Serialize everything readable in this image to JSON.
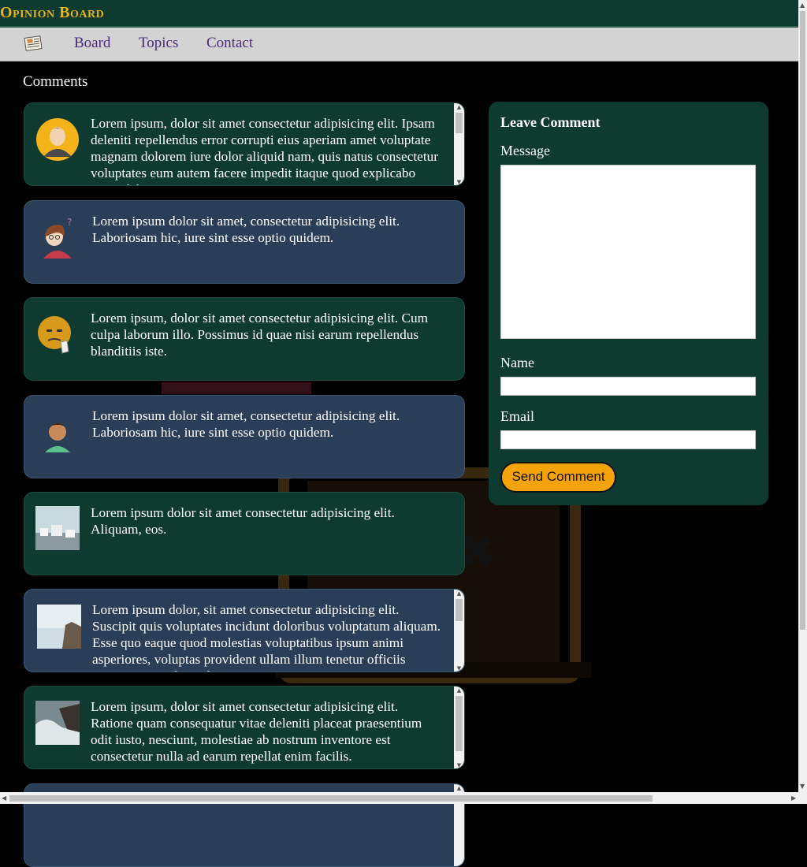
{
  "header": {
    "brand": "Opinion Board"
  },
  "nav": {
    "logo_icon": "newspaper-icon",
    "links": [
      "Board",
      "Topics",
      "Contact"
    ]
  },
  "comments_section": {
    "title": "Comments",
    "items": [
      {
        "avatar": "man-avatar-icon",
        "text": "Lorem ipsum, dolor sit amet consectetur adipisicing elit. Ipsam deleniti repellendus error corrupti eius aperiam amet voluptate magnam dolorem iure dolor aliquid nam, quis natus consectetur voluptates eum autem facere impedit itaque quod explicabo neque laboriosam minima?"
      },
      {
        "avatar": "thinking-woman-avatar-icon",
        "text": "Lorem ipsum dolor sit amet, consectetur adipisicing elit. Laboriosam hic, iure sint esse optio quidem."
      },
      {
        "avatar": "thinking-emoji-icon",
        "text": "Lorem ipsum, dolor sit amet consectetur adipisicing elit. Cum culpa laborum illo. Possimus id quae nisi earum repellendus blanditiis iste."
      },
      {
        "avatar": "boy-avatar-icon",
        "text": "Lorem ipsum dolor sit amet, consectetur adipisicing elit. Laboriosam hic, iure sint esse optio quidem."
      },
      {
        "avatar": "village-photo-icon",
        "text": "Lorem ipsum dolor sit amet consectetur adipisicing elit. Aliquam, eos."
      },
      {
        "avatar": "seaside-photo-icon",
        "text": "Lorem ipsum dolor, sit amet consectetur adipisicing elit. Suscipit quis voluptates incidunt doloribus voluptatum aliquam. Esse quo eaque quod molestias voluptatibus ipsum animi asperiores, voluptas provident ullam illum tenetur officiis consequatur velit. Voluptates, consequuntur."
      },
      {
        "avatar": "waves-photo-icon",
        "text": "Lorem ipsum, dolor sit amet consectetur adipisicing elit. Ratione quam consequatur vitae deleniti placeat praesentium odit iusto, nesciunt, molestiae ab nostrum inventore est consectetur nulla ad earum repellat enim facilis."
      },
      {
        "avatar": "",
        "text": ""
      }
    ]
  },
  "form": {
    "title": "Leave Comment",
    "message_label": "Message",
    "name_label": "Name",
    "email_label": "Email",
    "submit_label": "Send Comment"
  }
}
